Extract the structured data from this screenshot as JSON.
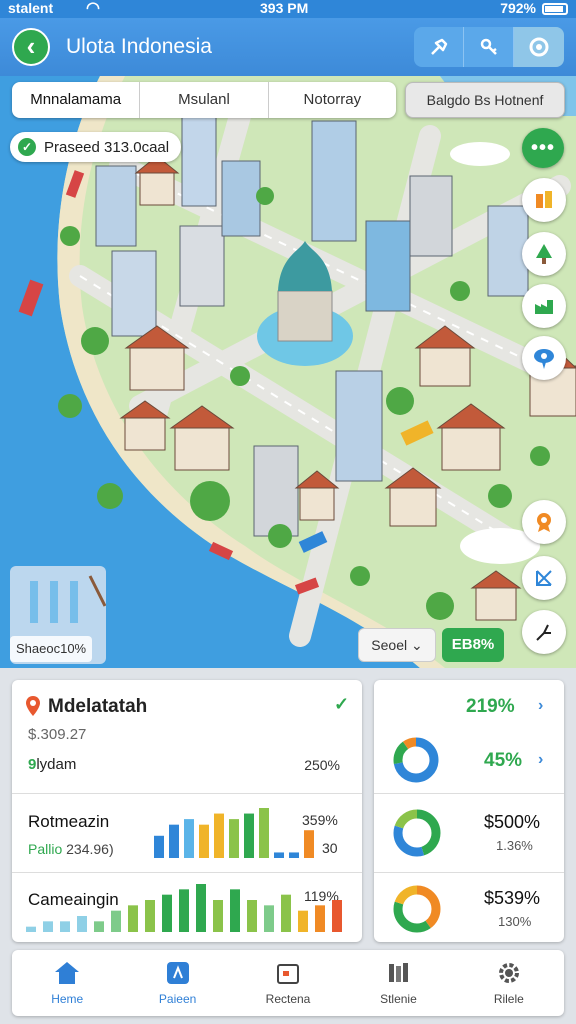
{
  "status": {
    "carrier": "stalent",
    "time": "393 PM",
    "battery": "792%"
  },
  "header": {
    "title": "Ulota Indonesia",
    "back_icon": "arrow-left-icon",
    "actions": [
      "pin-icon",
      "link-icon",
      "globe-icon"
    ]
  },
  "tabs": [
    {
      "label": "Mnnalamama"
    },
    {
      "label": "Msulanl"
    },
    {
      "label": "Notorray"
    }
  ],
  "tab_extra": "Balgdo Bs Hotnenf",
  "progress_pill": "Praseed 313.0caal",
  "map": {
    "more_button": "•••",
    "rail_icons": [
      "building-icon",
      "tree-icon",
      "factory-icon",
      "location-pin-icon",
      "badge-icon",
      "expand-icon",
      "road-icon"
    ],
    "stats_label": "Shaeoc10%",
    "select_label": "Seoel",
    "go_label": "EB8%"
  },
  "summary": {
    "title": "Mdelatatah",
    "value": "$.309.27",
    "sub_prefix": "9",
    "sub_text": "lydam",
    "sub_pct": "250%"
  },
  "rows": [
    {
      "title": "Rotmeazin",
      "note_green": "Pallio",
      "note": "234.96)",
      "pct_top": "359%",
      "pct_bottom": "30"
    },
    {
      "title": "Cameaingin",
      "pct_top": "119%"
    }
  ],
  "chart_data": [
    {
      "type": "bar",
      "values": [
        4,
        6,
        7,
        6,
        8,
        7,
        8,
        9,
        1,
        1,
        5
      ],
      "colors": [
        "#2f86d8",
        "#2f86d8",
        "#5ab4e8",
        "#f0b429",
        "#f0b429",
        "#8bc34a",
        "#2fa84f",
        "#8bc34a",
        "#2f86d8",
        "#2f86d8",
        "#f08a24"
      ]
    },
    {
      "type": "bar",
      "values": [
        1,
        2,
        2,
        3,
        2,
        4,
        5,
        6,
        7,
        8,
        9,
        6,
        8,
        6,
        5,
        7,
        4,
        5,
        6
      ],
      "colors": [
        "#8fd0e6",
        "#8fd0e6",
        "#8fd0e6",
        "#8fd0e6",
        "#7ecb8a",
        "#7ecb8a",
        "#8bc34a",
        "#8bc34a",
        "#2fa84f",
        "#2fa84f",
        "#2fa84f",
        "#8bc34a",
        "#2fa84f",
        "#8bc34a",
        "#7ecb8a",
        "#8bc34a",
        "#f0b429",
        "#f08a24",
        "#e8582f"
      ]
    }
  ],
  "right_panel": [
    {
      "pct": "219%"
    },
    {
      "pct": "45%",
      "donut": [
        0.72,
        0.18,
        0.1
      ],
      "donut_colors": [
        "#2f86d8",
        "#2fa84f",
        "#f08a24"
      ]
    },
    {
      "money": "$500%",
      "sub": "1.36%",
      "donut": [
        0.45,
        0.35,
        0.2
      ],
      "donut_colors": [
        "#2fa84f",
        "#2f86d8",
        "#8bc34a"
      ]
    },
    {
      "money": "$539%",
      "sub": "130%",
      "donut": [
        0.4,
        0.4,
        0.2
      ],
      "donut_colors": [
        "#f08a24",
        "#2fa84f",
        "#f0b429"
      ]
    }
  ],
  "nav": [
    {
      "label": "Heme",
      "icon": "home-icon"
    },
    {
      "label": "Paieen",
      "icon": "map-icon"
    },
    {
      "label": "Rectena",
      "icon": "calendar-icon"
    },
    {
      "label": "Stlenie",
      "icon": "library-icon"
    },
    {
      "label": "Rilele",
      "icon": "gear-icon"
    }
  ]
}
